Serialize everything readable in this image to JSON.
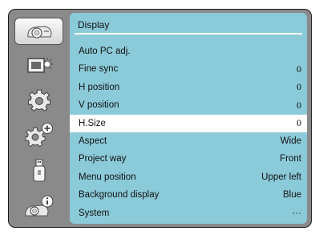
{
  "sidebar": {
    "items": [
      {
        "icon": "projector-icon",
        "active": true
      },
      {
        "icon": "display-settings-icon",
        "active": false
      },
      {
        "icon": "gear-icon",
        "active": false
      },
      {
        "icon": "gear-plus-icon",
        "active": false
      },
      {
        "icon": "usb-icon",
        "active": false
      },
      {
        "icon": "projector-info-icon",
        "active": false
      }
    ]
  },
  "panel": {
    "title": "Display",
    "rows": [
      {
        "label": "Auto PC adj.",
        "value": ""
      },
      {
        "label": "Fine sync",
        "value": "0"
      },
      {
        "label": "H position",
        "value": "0"
      },
      {
        "label": "V position",
        "value": "0"
      },
      {
        "label": "H.Size",
        "value": "0"
      },
      {
        "label": "Aspect",
        "value": "Wide"
      },
      {
        "label": "Project way",
        "value": "Front"
      },
      {
        "label": "Menu position",
        "value": "Upper left"
      },
      {
        "label": "Background display",
        "value": "Blue"
      },
      {
        "label": "System",
        "value": "···"
      }
    ],
    "selected_index": 4
  },
  "colors": {
    "panel_bg": "#8bcad9",
    "frame_bg": "#8a8a8a",
    "selected_row": "#ffffff"
  }
}
